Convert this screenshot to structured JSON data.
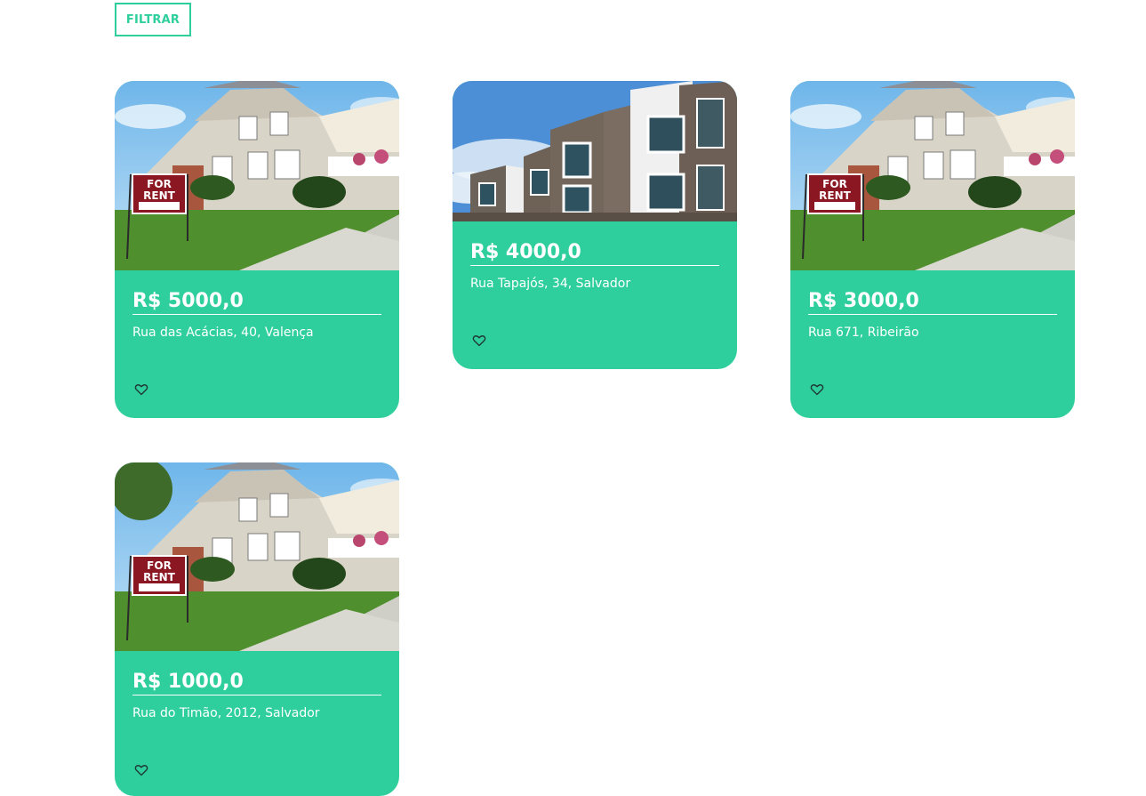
{
  "toolbar": {
    "filter_label": "FILTRAR"
  },
  "colors": {
    "accent": "#2fcf9d",
    "card_text": "#ffffff"
  },
  "listings": [
    {
      "price": "R$ 5000,0",
      "address": "Rua das Acácias, 40, Valença",
      "image": "house-for-rent-photo",
      "sign_line1": "FOR",
      "sign_line2": "RENT",
      "favorite_icon": "heart-outline-icon"
    },
    {
      "price": "R$ 4000,0",
      "address": "Rua Tapajós, 34, Salvador",
      "image": "apartment-building-photo",
      "favorite_icon": "heart-outline-icon"
    },
    {
      "price": "R$ 3000,0",
      "address": "Rua 671, Ribeirão",
      "image": "house-for-rent-photo",
      "sign_line1": "FOR",
      "sign_line2": "RENT",
      "favorite_icon": "heart-outline-icon"
    },
    {
      "price": "R$ 1000,0",
      "address": "Rua do Timão, 2012, Salvador",
      "image": "house-for-rent-photo",
      "sign_line1": "FOR",
      "sign_line2": "RENT",
      "favorite_icon": "heart-outline-icon"
    }
  ]
}
